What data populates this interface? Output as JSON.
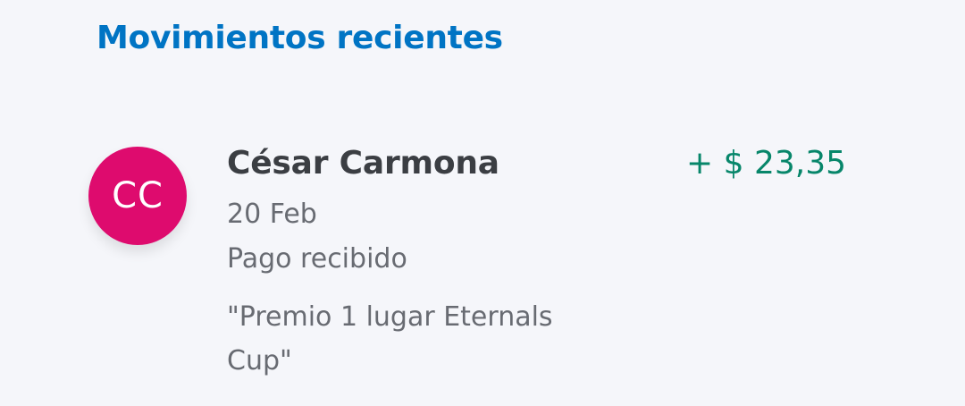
{
  "section": {
    "title": "Movimientos recientes"
  },
  "transaction": {
    "avatar_initials": "CC",
    "avatar_color": "#de0b6e",
    "name": "César Carmona",
    "amount": "+ $ 23,35",
    "amount_color": "#07866a",
    "date": "20 Feb",
    "type": "Pago recibido",
    "note": "\"Premio 1 lugar Eternals Cup\""
  },
  "colors": {
    "title": "#0074c4",
    "background": "#f5f6fa"
  }
}
